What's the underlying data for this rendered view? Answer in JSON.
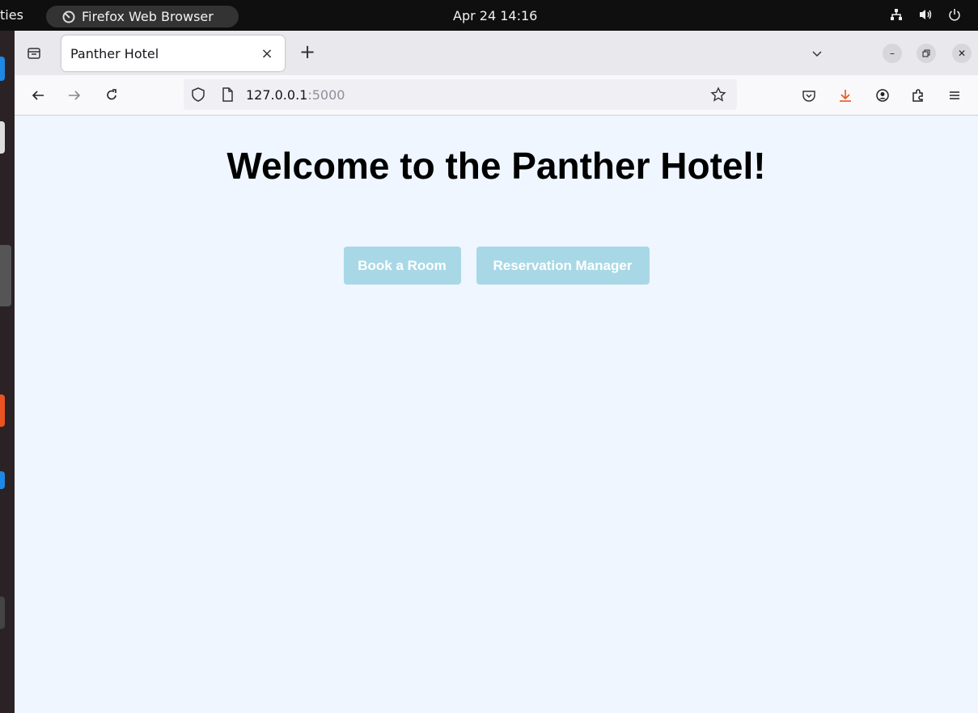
{
  "topbar": {
    "activities": "ties",
    "app_name": "Firefox Web Browser",
    "clock": "Apr 24  14:16"
  },
  "browser": {
    "tab_title": "Panther Hotel",
    "url_host": "127.0.0.1",
    "url_port": ":5000"
  },
  "page": {
    "heading": "Welcome to the Panther Hotel!",
    "buttons": {
      "book": "Book a Room",
      "manager": "Reservation Manager"
    }
  },
  "colors": {
    "page_bg": "#eff6ff",
    "button_bg": "#a8d8e6",
    "download_icon": "#e8541f"
  }
}
